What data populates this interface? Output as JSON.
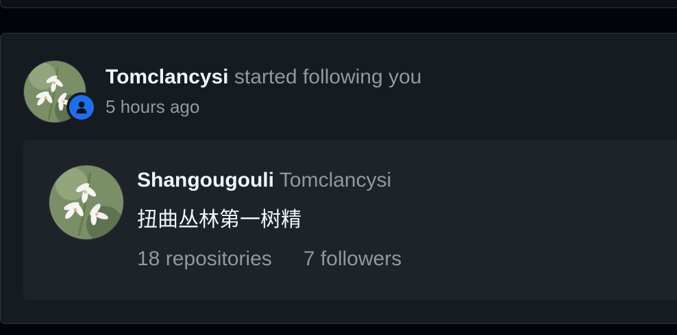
{
  "event": {
    "actor": "Tomclancysi",
    "action": "started following you",
    "time": "5 hours ago",
    "badge_icon": "person-icon",
    "badge_color": "#1f6feb"
  },
  "user_card": {
    "display_name": "Shangougouli",
    "login": "Tomclancysi",
    "bio": "扭曲丛林第一树精",
    "repositories": "18 repositories",
    "followers": "7 followers"
  },
  "colors": {
    "page_bg": "#010409",
    "card_bg": "#161b22",
    "inner_card_bg": "#1e2229",
    "text_primary": "#f0f6fc",
    "text_muted": "#9198a1",
    "border": "#30363d"
  }
}
